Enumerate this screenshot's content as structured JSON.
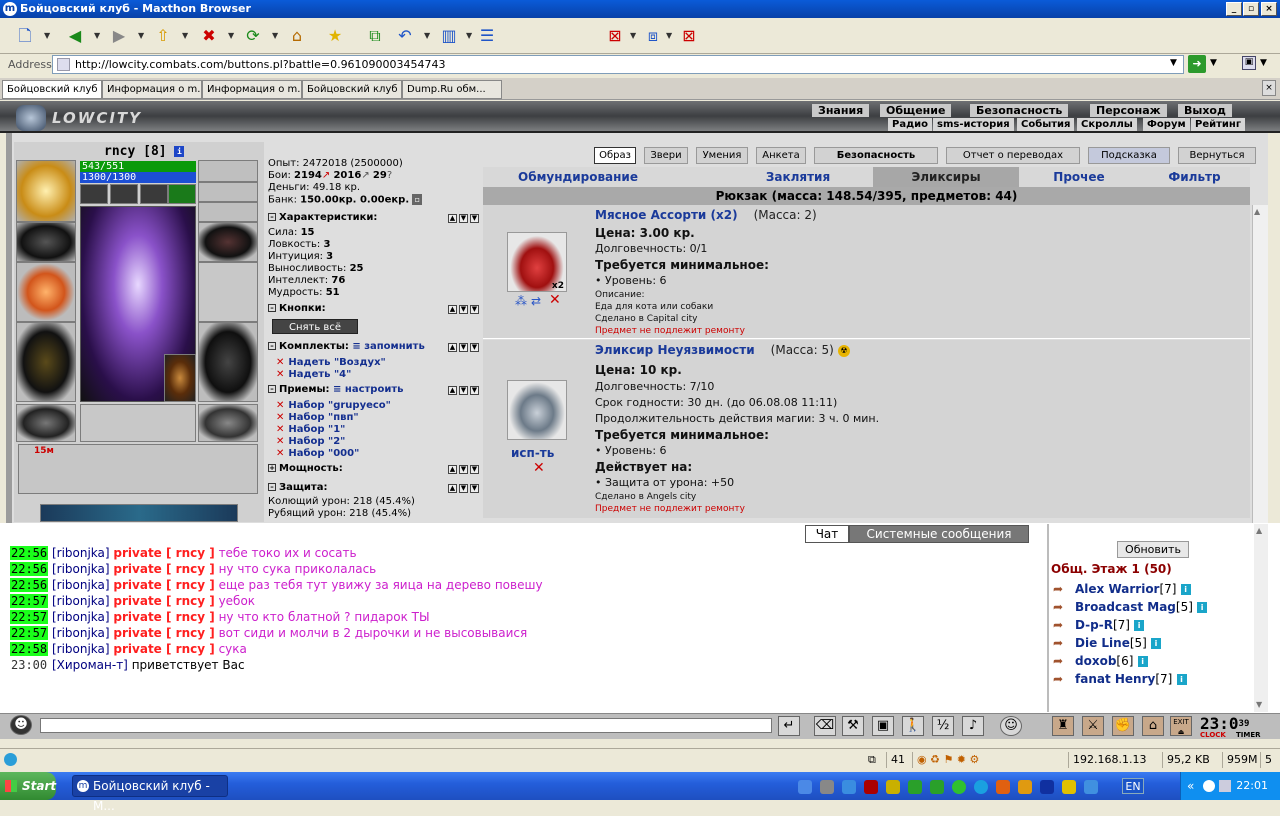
{
  "window": {
    "title": "Бойцовский клуб - Maxthon Browser",
    "icon": "m"
  },
  "address": {
    "label": "Address",
    "url": "http://lowcity.combats.com/buttons.pl?battle=0.961090003454743"
  },
  "browser_tabs": [
    {
      "label": "Бойцовский клуб"
    },
    {
      "label": "Информация о m..."
    },
    {
      "label": "Информация о m..."
    },
    {
      "label": "Бойцовский клуб"
    },
    {
      "label": "Dump.Ru обм..."
    }
  ],
  "game": {
    "logo": "LOWCITY",
    "menu_top": [
      "Знания",
      "Общение",
      "Безопасность",
      "Персонаж",
      "Выход"
    ],
    "menu_bottom": [
      "Радио",
      "sms-история",
      "События",
      "Скроллы",
      "Форум",
      "Рейтинг"
    ]
  },
  "character": {
    "nick": "rncy",
    "level": "[8]",
    "hp": "543/551",
    "mp": "1300/1300",
    "scroll_badge": "15м"
  },
  "stats": {
    "exp": "Опыт: 2472018 (2500000)",
    "fights_label": "Бои:",
    "fights_win": "2194",
    "fights_lose": "2016",
    "fights_draw": "29",
    "money": "Деньги: 49.18 кр.",
    "bank_label": "Банк:",
    "bank_value": "150.00кр. 0.00екр.",
    "characteristics_title": "Характеристики:",
    "attributes": [
      {
        "name": "Сила:",
        "value": "15"
      },
      {
        "name": "Ловкость:",
        "value": "3"
      },
      {
        "name": "Интуиция:",
        "value": "3"
      },
      {
        "name": "Выносливость:",
        "value": "25"
      },
      {
        "name": "Интеллект:",
        "value": "76"
      },
      {
        "name": "Мудрость:",
        "value": "51"
      }
    ],
    "buttons_title": "Кнопки:",
    "remove_all": "Снять всё",
    "sets_title": "Комплекты:",
    "sets_remember": "запомнить",
    "sets": [
      "Надеть \"Воздух\"",
      "Надеть \"4\""
    ],
    "tricks_title": "Приемы:",
    "tricks_setup": "настроить",
    "tricks": [
      "Набор \"grupyeco\"",
      "Набор \"пвп\"",
      "Набор \"1\"",
      "Набор \"2\"",
      "Набор \"000\""
    ],
    "power_title": "Мощность:",
    "defense_title": "Защита:",
    "defense": [
      "Колющий урон: 218 (45.4%)",
      "Рубящий урон: 218 (45.4%)"
    ]
  },
  "top_buttons": [
    "Образ",
    "Звери",
    "Умения",
    "Анкета",
    "Безопасность",
    "Отчет о переводах",
    "Подсказка",
    "Вернуться"
  ],
  "inv_tabs": [
    "Обмундирование",
    "Заклятия",
    "Эликсиры",
    "Прочее",
    "Фильтр"
  ],
  "backpack": "Рюкзак (масса: 148.54/395, предметов: 44)",
  "items": [
    {
      "name": "Мясное Ассорти (x2)",
      "mass": "(Масса: 2)",
      "badge": "x2",
      "lines": [
        {
          "t": "Цена: 3.00 кр.",
          "c": "b"
        },
        {
          "t": "Долговечность: 0/1",
          "c": ""
        },
        {
          "t": "Требуется минимальное:",
          "c": "b"
        },
        {
          "t": "• Уровень: 6",
          "c": ""
        },
        {
          "t": "Описание:",
          "c": "s"
        },
        {
          "t": "Еда для кота или собаки",
          "c": "s"
        },
        {
          "t": "Сделано в Capital city",
          "c": "s"
        },
        {
          "t": "Предмет не подлежит ремонту",
          "c": "r"
        }
      ]
    },
    {
      "name": "Эликсир Неуязвимости",
      "mass": "(Масса: 5)",
      "use_label": "исп-ть",
      "lines": [
        {
          "t": "Цена: 10 кр.",
          "c": "b"
        },
        {
          "t": "Долговечность: 7/10",
          "c": ""
        },
        {
          "t": "Срок годности: 30 дн. (до 06.08.08 11:11)",
          "c": ""
        },
        {
          "t": "Продолжительность действия магии: 3 ч. 0 мин.",
          "c": ""
        },
        {
          "t": "Требуется минимальное:",
          "c": "b"
        },
        {
          "t": "• Уровень: 6",
          "c": ""
        },
        {
          "t": "Действует на:",
          "c": "b"
        },
        {
          "t": "• Защита от урона: +50",
          "c": ""
        },
        {
          "t": "Сделано в Angels city",
          "c": "s"
        },
        {
          "t": "Предмет не подлежит ремонту",
          "c": "r"
        }
      ]
    }
  ],
  "chat_tabs": [
    "Чат",
    "Системные сообщения"
  ],
  "chat": [
    {
      "time": "22:56",
      "who": "[ribonjka]",
      "priv": "private [ rncy ]",
      "text": "тебе токо их и сосать",
      "hl": true
    },
    {
      "time": "22:56",
      "who": "[ribonjka]",
      "priv": "private [ rncy ]",
      "text": "ну что сука приколалась",
      "hl": true
    },
    {
      "time": "22:56",
      "who": "[ribonjka]",
      "priv": "private [ rncy ]",
      "text": "еще раз тебя тут увижу за яица на дерево повешу",
      "hl": true
    },
    {
      "time": "22:57",
      "who": "[ribonjka]",
      "priv": "private [ rncy ]",
      "text": "уебок",
      "hl": true
    },
    {
      "time": "22:57",
      "who": "[ribonjka]",
      "priv": "private [ rncy ]",
      "text": "ну что кто блатной ? пидарок ТЫ",
      "hl": true
    },
    {
      "time": "22:57",
      "who": "[ribonjka]",
      "priv": "private [ rncy ]",
      "text": "вот сиди и молчи в 2 дырочки и не высовываися",
      "hl": true
    },
    {
      "time": "22:58",
      "who": "[ribonjka]",
      "priv": "private [ rncy ]",
      "text": "сука",
      "hl": true
    },
    {
      "time": "23:00",
      "who": "[Хироман-т]",
      "priv": "",
      "text": "приветствует Вас",
      "hl": false
    }
  ],
  "users": {
    "refresh": "Обновить",
    "room": "Общ. Этаж 1 (50)",
    "list": [
      {
        "name": "Alex Warrior",
        "lvl": "[7]"
      },
      {
        "name": "Broadcast Mag",
        "lvl": "[5]"
      },
      {
        "name": "D-p-R",
        "lvl": "[7]"
      },
      {
        "name": "Die Line",
        "lvl": "[5]"
      },
      {
        "name": "doxob",
        "lvl": "[6]"
      },
      {
        "name": "fanat Henry",
        "lvl": "[7]"
      }
    ]
  },
  "clock": {
    "time": "23:0",
    "sec": "39",
    "label1": "CLOCK",
    "label2": "TIMER",
    "exit": "EXIT"
  },
  "status": {
    "count": "41",
    "ip": "192.168.1.13",
    "size": "95,2 KB",
    "mem": "959M",
    "num": "5"
  },
  "taskbar": {
    "start": "Start",
    "task": "Бойцовский клуб - М...",
    "lang": "EN",
    "time": "22:01"
  }
}
